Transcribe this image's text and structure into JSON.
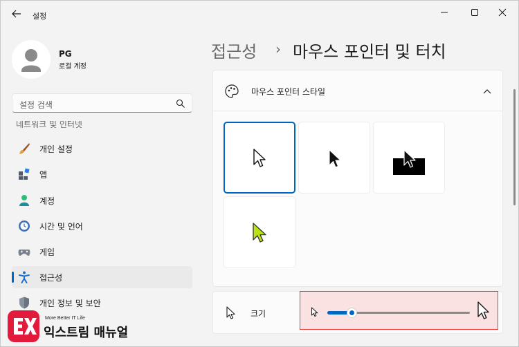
{
  "window": {
    "title": "설정"
  },
  "profile": {
    "name": "PG",
    "account_type": "로컬 계정"
  },
  "search": {
    "placeholder": "설정 검색"
  },
  "sidebar": {
    "partial_label": "네트워크 및 인터넷",
    "items": [
      {
        "label": "개인 설정",
        "icon": "paintbrush-icon"
      },
      {
        "label": "앱",
        "icon": "apps-icon"
      },
      {
        "label": "계정",
        "icon": "person-icon"
      },
      {
        "label": "시간 및 언어",
        "icon": "globe-clock-icon"
      },
      {
        "label": "게임",
        "icon": "gamepad-icon"
      },
      {
        "label": "접근성",
        "icon": "accessibility-icon",
        "active": true
      },
      {
        "label": "개인 정보 및 보안",
        "icon": "shield-icon"
      }
    ]
  },
  "breadcrumb": {
    "parent": "접근성",
    "separator": "›",
    "current": "마우스 포인터 및 터치"
  },
  "pointer_style": {
    "header_label": "마우스 포인터 스타일",
    "options": [
      {
        "name": "white",
        "selected": true
      },
      {
        "name": "black",
        "selected": false
      },
      {
        "name": "inverted",
        "selected": false
      },
      {
        "name": "custom-lime",
        "selected": false
      }
    ]
  },
  "size": {
    "label": "크기",
    "value_fraction": 0.17
  },
  "colors": {
    "accent": "#0067c0",
    "custom_pointer": "#b9e114",
    "highlight_border": "#e33333"
  },
  "watermark": {
    "tagline": "More Better IT Life",
    "name": "익스트림 매뉴얼"
  }
}
